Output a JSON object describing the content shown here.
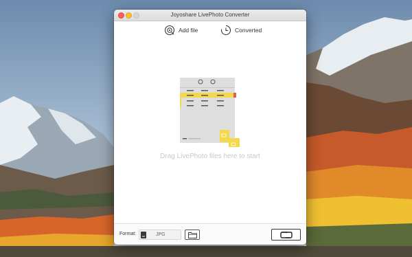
{
  "window": {
    "title": "Joyoshare LivePhoto Converter"
  },
  "toolbar": {
    "add_file_label": "Add file",
    "converted_label": "Converted"
  },
  "drop_area": {
    "hint": "Drag LivePhoto files here to start"
  },
  "bottom_bar": {
    "format_label": "Format:",
    "format_value": "JPG"
  },
  "icons": {
    "add_file": "add-file-icon",
    "converted": "clock-icon",
    "format": "jpg-file-icon",
    "output_folder": "folder-icon",
    "convert": "convert-icon"
  },
  "colors": {
    "accent_yellow": "#f5d84a",
    "accent_red": "#e0604a",
    "close": "#ff5f57",
    "minimize": "#febc2e"
  }
}
